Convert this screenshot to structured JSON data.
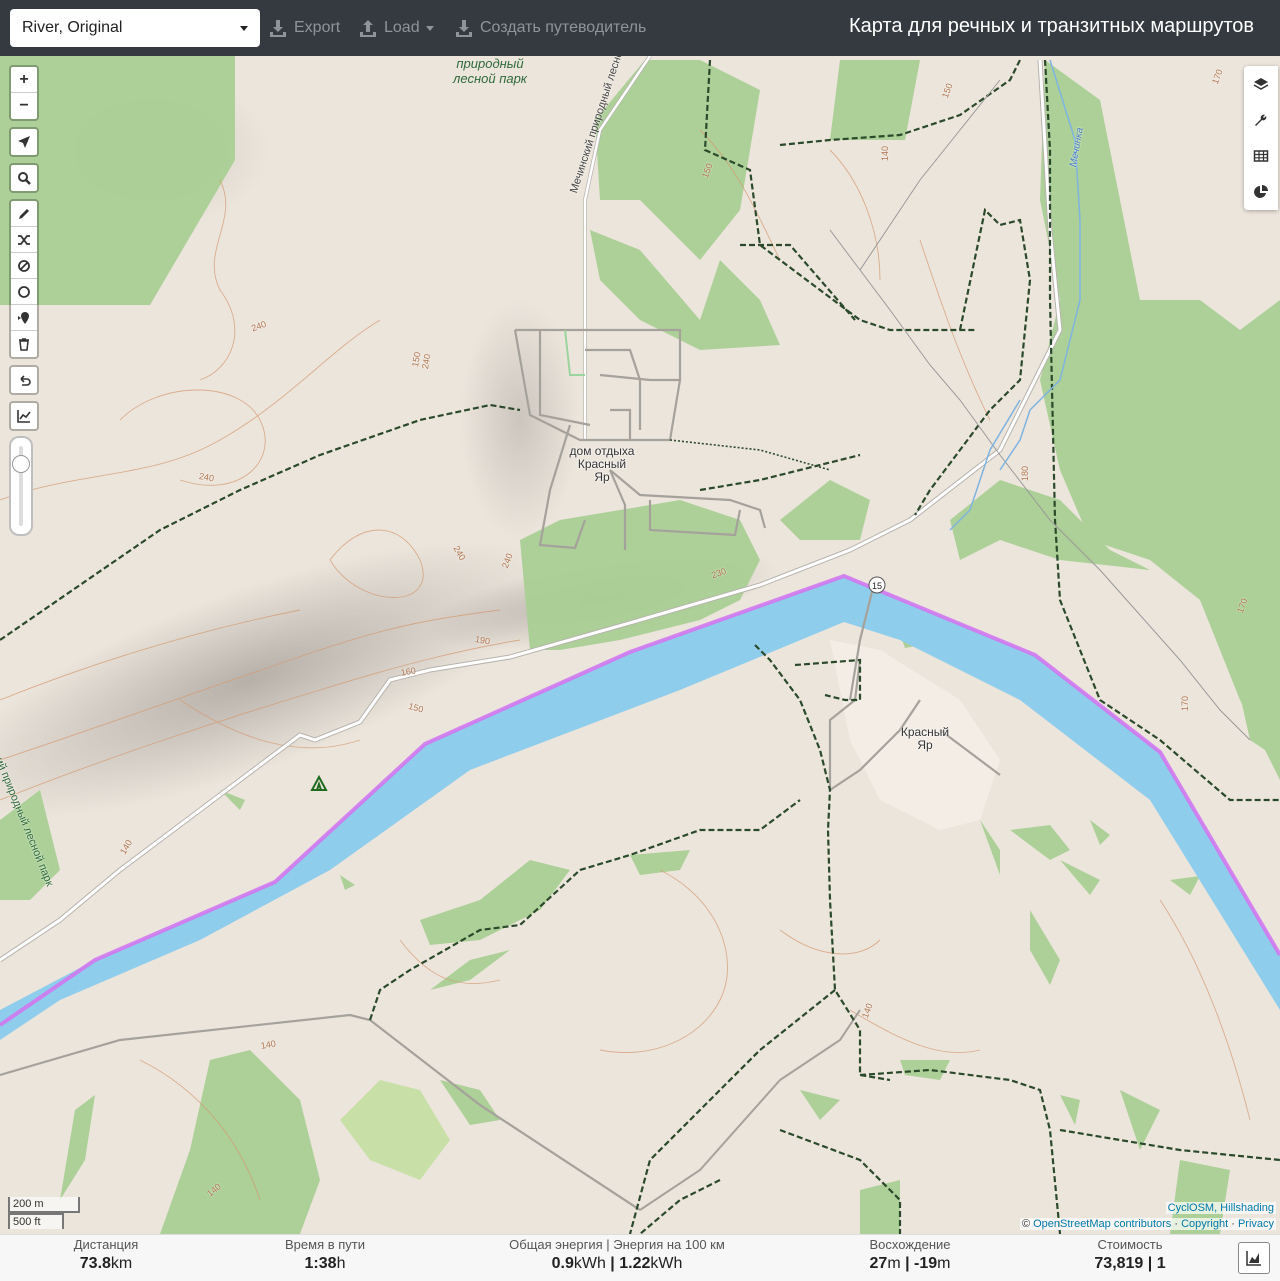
{
  "topbar": {
    "profile": "River, Original",
    "export_label": "Export",
    "load_label": "Load",
    "guide_label": "Создать путеводитель",
    "title": "Карта для речных и транзитных маршрутов"
  },
  "map": {
    "labels": {
      "park_top": "природный лесной парк",
      "park_top_l1": "природный",
      "park_top_l2": "лесной парк",
      "road_vertical": "Мечинский природный лесной",
      "park_left": "ий природный лесной парк",
      "resort_l1": "дом отдыха",
      "resort_l2": "Красный",
      "resort_l3": "Яр",
      "village_l1": "Красный",
      "village_l2": "Яр",
      "road_shield": "15",
      "stream": "Мечинка"
    },
    "contours": [
      "240",
      "240",
      "240",
      "240",
      "240",
      "230",
      "190",
      "160",
      "150",
      "140",
      "140",
      "140",
      "140",
      "140",
      "180",
      "170",
      "170",
      "170",
      "150",
      "150",
      "150"
    ],
    "icons": [
      "campsite-icon"
    ]
  },
  "left_toolbar": {
    "zoom_in": "+",
    "zoom_out": "−",
    "tools": [
      "locate-icon",
      "search-icon",
      "draw-icon",
      "shuffle-icon",
      "avoid-icon",
      "circle-icon",
      "poi-icon",
      "delete-icon",
      "undo-icon",
      "elevation-icon"
    ],
    "opacity": 0.78
  },
  "right_toolbar": [
    "layers-icon",
    "wrench-icon",
    "table-icon",
    "pie-icon"
  ],
  "scale": {
    "metric": "200 m",
    "imperial": "500 ft"
  },
  "attribution": {
    "line1": "CyclOSM, Hillshading",
    "line2_prefix": "© ",
    "osm": "OpenStreetMap contributors",
    "copyright": "Copyright",
    "privacy": "Privacy",
    "sep": " · "
  },
  "stats": {
    "distance_label": "Дистанция",
    "distance_value": "73.8",
    "distance_unit": "km",
    "time_label": "Время в пути",
    "time_value": "1:38",
    "time_unit": "h",
    "energy_label": "Общая энергия | Энергия на 100 км",
    "energy_total": "0.9",
    "energy_total_unit": "kWh",
    "energy_per100": "1.22",
    "energy_per100_unit": "kWh",
    "ascent_label": "Восхождение",
    "ascent_up": "27",
    "ascent_down": "-19",
    "ascent_unit": "m",
    "cost_label": "Стоимость",
    "cost_value": "73,819",
    "cost_extra": "1"
  }
}
